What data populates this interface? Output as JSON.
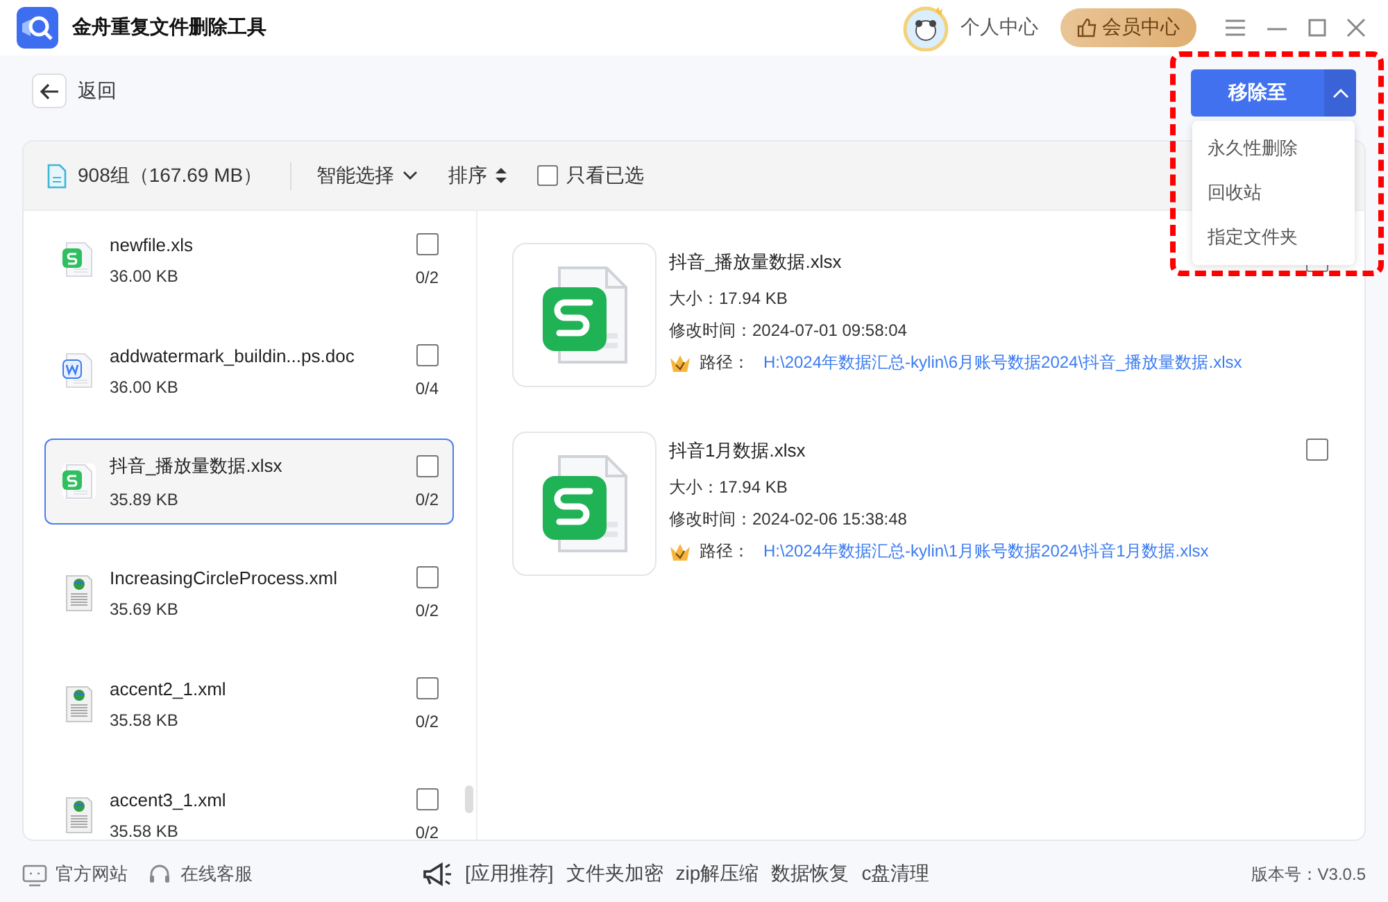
{
  "app": {
    "title": "金舟重复文件删除工具"
  },
  "header": {
    "profile": "个人中心",
    "vip": "会员中心"
  },
  "back": "返回",
  "move_button": {
    "label": "移除至",
    "expanded": true,
    "menu": [
      "永久性删除",
      "回收站",
      "指定文件夹"
    ]
  },
  "toolbar": {
    "summary": "908组（167.69 MB）",
    "smart_select": "智能选择",
    "sort": "排序",
    "only_selected": {
      "label": "只看已选",
      "checked": false
    }
  },
  "groups": [
    {
      "name": "newfile.xls",
      "size": "36.00 KB",
      "count": "0/2",
      "kind": "sheet",
      "selected": false,
      "checked": false
    },
    {
      "name": "addwatermark_buildin...ps.doc",
      "size": "36.00 KB",
      "count": "0/4",
      "kind": "doc",
      "selected": false,
      "checked": false
    },
    {
      "name": "抖音_播放量数据.xlsx",
      "size": "35.89 KB",
      "count": "0/2",
      "kind": "sheet",
      "selected": true,
      "checked": false
    },
    {
      "name": "IncreasingCircleProcess.xml",
      "size": "35.69 KB",
      "count": "0/2",
      "kind": "xml",
      "selected": false,
      "checked": false
    },
    {
      "name": "accent2_1.xml",
      "size": "35.58 KB",
      "count": "0/2",
      "kind": "xml",
      "selected": false,
      "checked": false
    },
    {
      "name": "accent3_1.xml",
      "size": "35.58 KB",
      "count": "0/2",
      "kind": "xml",
      "selected": false,
      "checked": false
    }
  ],
  "files": [
    {
      "name": "抖音_播放量数据.xlsx",
      "size": "大小：17.94 KB",
      "modified": "修改时间：2024-07-01 09:58:04",
      "path_label": "路径：",
      "path": "H:\\2024年数据汇总-kylin\\6月账号数据2024\\抖音_播放量数据.xlsx",
      "checked": false
    },
    {
      "name": "抖音1月数据.xlsx",
      "size": "大小：17.94 KB",
      "modified": "修改时间：2024-02-06 15:38:48",
      "path_label": "路径：",
      "path": "H:\\2024年数据汇总-kylin\\1月账号数据2024\\抖音1月数据.xlsx",
      "checked": false
    }
  ],
  "footer": {
    "links": [
      "官方网站",
      "在线客服"
    ],
    "promo": [
      "[应用推荐]",
      "文件夹加密",
      "zip解压缩",
      "数据恢复",
      "c盘清理"
    ],
    "version": "版本号：V3.0.5"
  }
}
